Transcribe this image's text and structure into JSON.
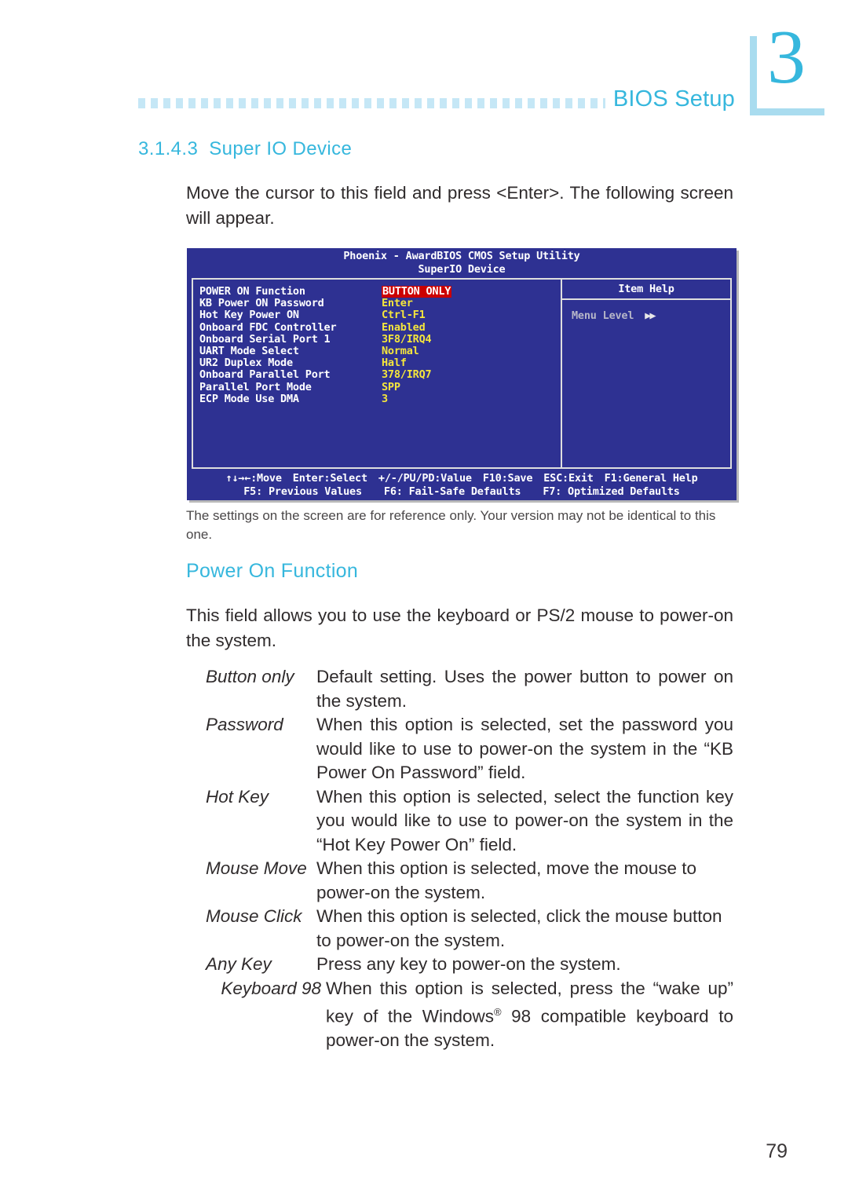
{
  "chapter": {
    "number": "3"
  },
  "running_head": {
    "title": "BIOS Setup"
  },
  "section": {
    "number": "3.1.4.3",
    "title": "Super IO Device"
  },
  "intro_paragraph": "Move the cursor to this field and press <Enter>. The following screen will appear.",
  "figure_caption": "The settings on the screen are for reference only. Your version may not be identical to this one.",
  "subsection": {
    "title": "Power On Function",
    "paragraph": "This field allows you to use the keyboard or PS/2 mouse to power-on the system."
  },
  "definitions": [
    {
      "term": "Button only",
      "description": "Default setting. Uses the power button to power on the system."
    },
    {
      "term": "Password",
      "description": "When this option is selected, set the password you would like to use to power-on the system in the “KB Power On Password” field."
    },
    {
      "term": "Hot Key",
      "description": "When this option is selected, select the function key you would like to use to power-on the system in the “Hot Key Power On” field."
    },
    {
      "term": "Mouse Move",
      "description": "When this option is selected, move the mouse to power-on the system."
    },
    {
      "term": "Mouse Click",
      "description": "When this option is selected, click the mouse button to power-on the system."
    },
    {
      "term": "Any Key",
      "description": "Press any key to power-on the system."
    },
    {
      "term": "Keyboard 98",
      "description_pre": "When this option is selected, press the “wake up” key of the Windows",
      "description_sup": "®",
      "description_post": " 98 compatible keyboard to power-on the system."
    }
  ],
  "bios": {
    "title_line1": "Phoenix - AwardBIOS CMOS Setup Utility",
    "title_line2": "SuperIO Device",
    "menu_items": [
      {
        "label": "POWER ON Function",
        "value": "BUTTON ONLY",
        "highlighted": true
      },
      {
        "label": "KB Power ON Password",
        "value": "Enter",
        "highlighted": false
      },
      {
        "label": "Hot Key Power ON",
        "value": "Ctrl-F1",
        "highlighted": false
      },
      {
        "label": "Onboard FDC Controller",
        "value": "Enabled",
        "highlighted": false
      },
      {
        "label": "Onboard Serial Port 1",
        "value": "3F8/IRQ4",
        "highlighted": false
      },
      {
        "label": "UART Mode Select",
        "value": "Normal",
        "highlighted": false
      },
      {
        "label": "UR2 Duplex Mode",
        "value": "Half",
        "highlighted": false
      },
      {
        "label": "Onboard Parallel Port",
        "value": "378/IRQ7",
        "highlighted": false
      },
      {
        "label": "Parallel Port Mode",
        "value": "SPP",
        "highlighted": false
      },
      {
        "label": "ECP Mode Use DMA",
        "value": "3",
        "highlighted": false
      }
    ],
    "help": {
      "title": "Item Help",
      "menu_level_label": "Menu Level",
      "menu_level_arrows": "▶▶"
    },
    "footer": {
      "line1": [
        "↑↓→←:Move",
        "Enter:Select",
        "+/-/PU/PD:Value",
        "F10:Save",
        "ESC:Exit",
        "F1:General Help"
      ],
      "line2": [
        "F5: Previous Values",
        "F6: Fail-Safe Defaults",
        "F7: Optimized Defaults"
      ]
    },
    "colors": {
      "background": "#2e3192",
      "label": "#ffffff",
      "value": "#f5e63c",
      "highlight_bg": "#cc0000",
      "help_text": "#b6b6c8"
    }
  },
  "page_number": "79"
}
